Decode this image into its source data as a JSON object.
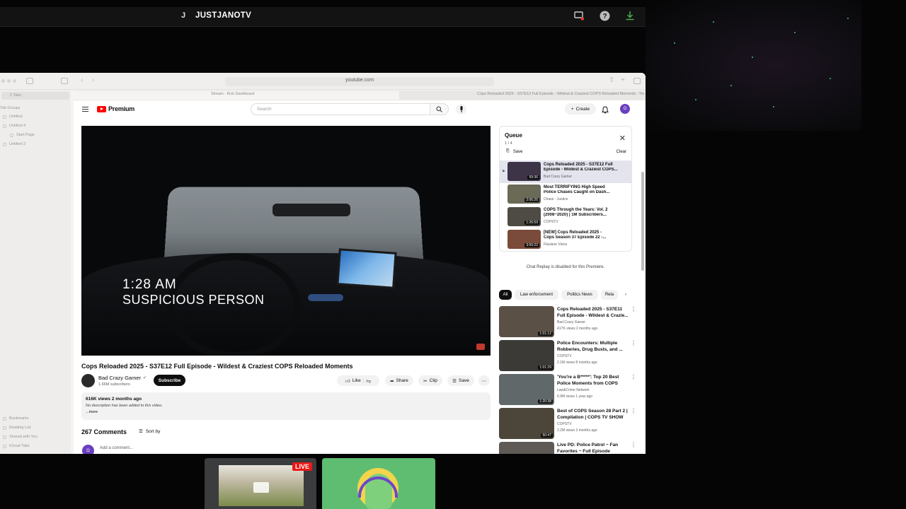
{
  "stream": {
    "avatar_letter": "J",
    "channel_name": "JUSTJANOTV",
    "icons": [
      "cast-icon",
      "help-icon",
      "download-icon"
    ]
  },
  "browser": {
    "url": "youtube.com",
    "tabs": [
      "Stream - Kick Dashboard",
      "Cops Reloaded 2025 - S37E12 Full Episode - Wildest & Craziest COPS Reloaded Moments - YouTube"
    ],
    "sidebar": {
      "top": "2 Tabs",
      "group_header": "Tab Groups",
      "groups": [
        "Untitled",
        "Untitled 4",
        "Start Page",
        "Untitled 3"
      ],
      "bottom": [
        "Bookmarks",
        "Reading List",
        "Shared with You",
        "iCloud Tabs"
      ]
    }
  },
  "youtube": {
    "brand": "Premium",
    "search_placeholder": "Search",
    "create_label": "Create",
    "user_initial": "O",
    "video": {
      "overlay_time": "1:28 AM",
      "overlay_text": "SUSPICIOUS PERSON",
      "title": "Cops Reloaded 2025 - S37E12 Full Episode - Wildest & Craziest COPS Reloaded Moments",
      "channel": "Bad Crazy Gamer",
      "subscribers": "1.66M subscribers",
      "subscribe_label": "Subscribe",
      "actions": {
        "like": "Like",
        "share": "Share",
        "clip": "Clip",
        "save": "Save"
      },
      "views_date": "616K views  2 months ago",
      "description": "No description has been added to this video.",
      "more": "...more",
      "comments_count": "267 Comments",
      "sort_by": "Sort by",
      "add_comment": "Add a comment..."
    },
    "queue": {
      "title": "Queue",
      "count": "1 / 4",
      "save": "Save",
      "clear": "Clear",
      "items": [
        {
          "title1": "Cops Reloaded 2025 - S37E12 Full",
          "title2": "Episode - Wildest & Craziest COPS...",
          "channel": "Bad Crazy Gamer",
          "duration": "59:36",
          "color": "#3d3448"
        },
        {
          "title1": "Most TERRIFYING High Speed",
          "title2": "Police Chases Caught on Dash...",
          "channel": "Chase - Justice",
          "duration": "2:06:26",
          "color": "#6b6a57"
        },
        {
          "title1": "COPS Through the Years: Vol. 2",
          "title2": "(2008~2020) | 1M Subscribers...",
          "channel": "COPSTV",
          "duration": "1:26:59",
          "color": "#4e4b44"
        },
        {
          "title1": "[NEW] Cops Reloaded 2025 -",
          "title2": "Cops Season 37 Episode 22 -...",
          "channel": "Flaviane Vieira",
          "duration": "3:50:22",
          "color": "#7a4a3a"
        }
      ]
    },
    "chat_replay": "Chat Replay is disabled for this Premiere.",
    "chips": [
      "All",
      "Law enforcement",
      "Politics News",
      "Rela"
    ],
    "recommendations": [
      {
        "title1": "Cops Reloaded 2025 - S37E11",
        "title2": "Full Episode - Wildest & Crazie...",
        "channel": "Bad Crazy Gamer",
        "meta": "417K views  2 months ago",
        "duration": "1:01:12",
        "color": "#5a5046"
      },
      {
        "title1": "Police Encounters: Multiple",
        "title2": "Robberies, Drug Busts, and ...",
        "channel": "COPSTV",
        "meta": "2.1M views  8 months ago",
        "duration": "1:01:29",
        "color": "#3c3a36"
      },
      {
        "title1": "'You're a B*****': Top 20 Best",
        "title2": "Police Moments from COPS",
        "channel": "Law&Crime Network",
        "meta": "6.9M views  1 year ago",
        "duration": "1:20:38",
        "color": "#61686a"
      },
      {
        "title1": "Best of COPS Season 28 Part 2 |",
        "title2": "Compilation | COPS TV SHOW",
        "channel": "COPSTV",
        "meta": "2.2M views  3 months ago",
        "duration": "50:47",
        "color": "#4b4639"
      },
      {
        "title1": "Live PD: Police Patrol ~ Fan",
        "title2": "Favorites ~ Full Episode",
        "channel": "",
        "meta": "",
        "duration": "",
        "color": "#5f5a55"
      }
    ]
  },
  "bottom": {
    "live_badge": "LIVE"
  }
}
